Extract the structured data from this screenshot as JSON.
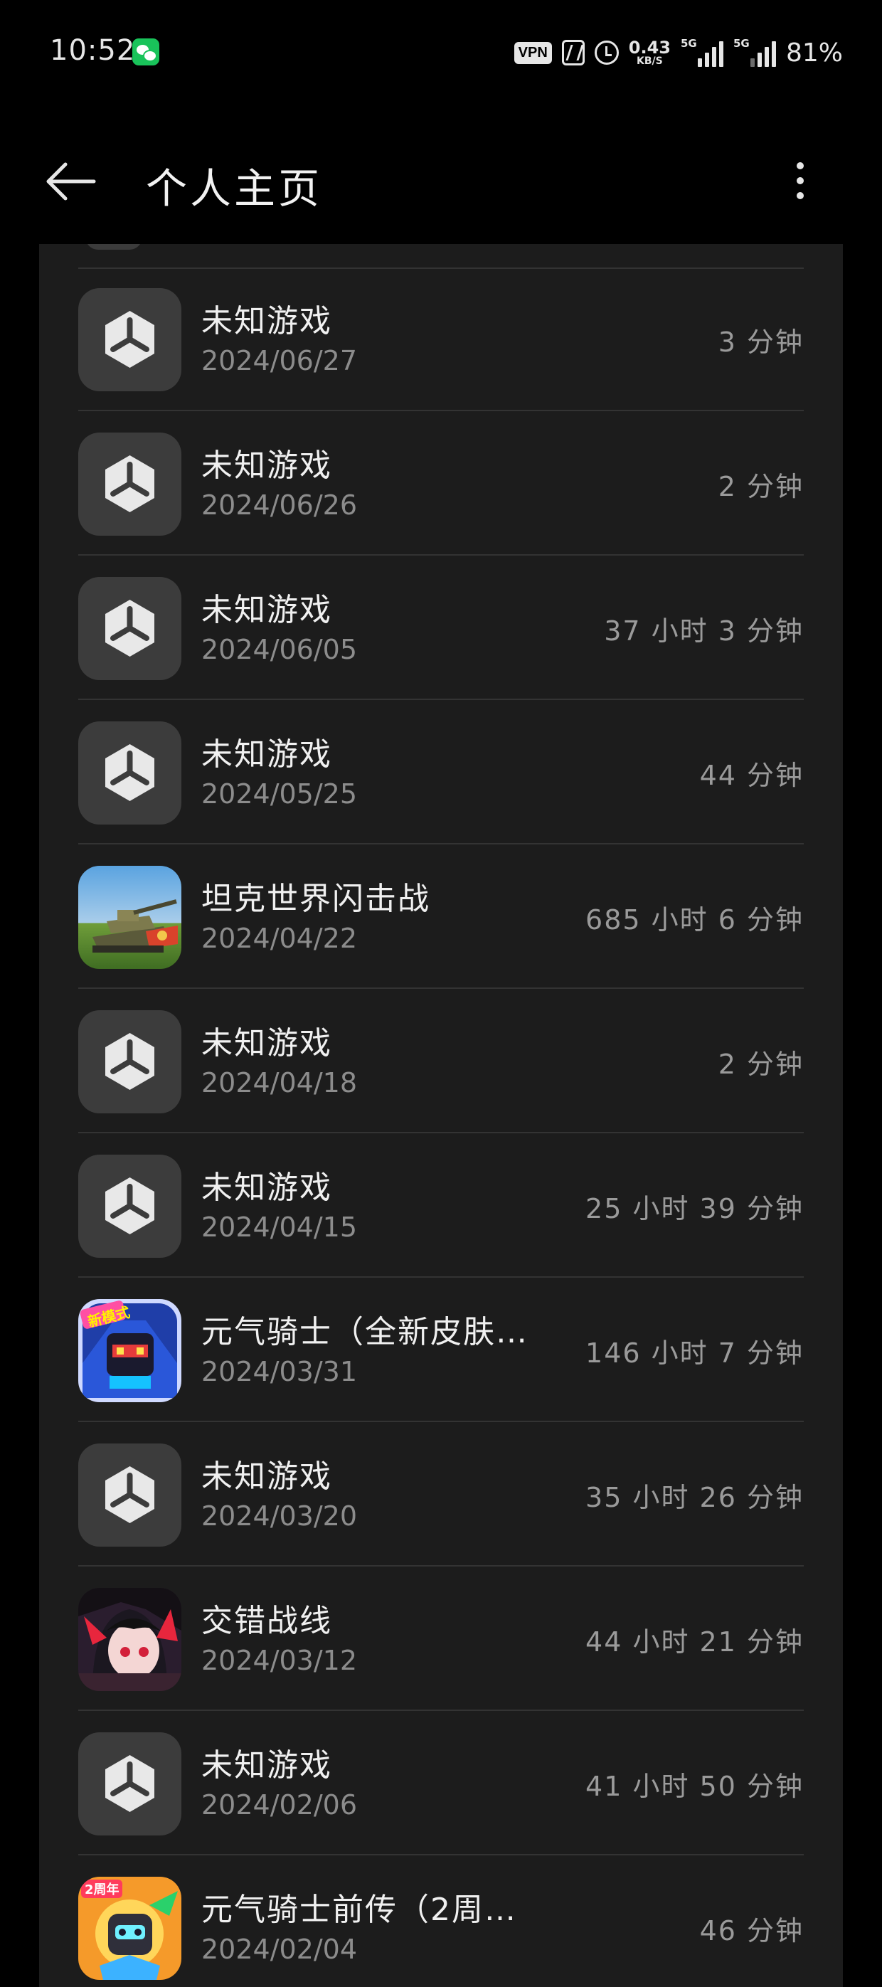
{
  "status_bar": {
    "time": "10:52",
    "vpn_label": "VPN",
    "net_speed_value": "0.43",
    "net_speed_unit": "KB/S",
    "signal_1_label": "5G",
    "signal_2_label": "5G",
    "battery": "81%",
    "icons": [
      "wechat-icon",
      "vpn-icon",
      "nfc-icon",
      "alarm-icon",
      "signal-icon",
      "signal-icon"
    ]
  },
  "app_bar": {
    "title": "个人主页",
    "back_icon": "arrow-left",
    "more_icon": "more-vertical"
  },
  "games": [
    {
      "name": "未知游戏",
      "date": "2024/06/27",
      "playtime": "3 分钟",
      "icon": "unknown-game-icon"
    },
    {
      "name": "未知游戏",
      "date": "2024/06/26",
      "playtime": "2 分钟",
      "icon": "unknown-game-icon"
    },
    {
      "name": "未知游戏",
      "date": "2024/06/05",
      "playtime": "37 小时 3 分钟",
      "icon": "unknown-game-icon"
    },
    {
      "name": "未知游戏",
      "date": "2024/05/25",
      "playtime": "44 分钟",
      "icon": "unknown-game-icon"
    },
    {
      "name": "坦克世界闪击战",
      "date": "2024/04/22",
      "playtime": "685 小时 6 分钟",
      "icon": "tank-game-icon"
    },
    {
      "name": "未知游戏",
      "date": "2024/04/18",
      "playtime": "2 分钟",
      "icon": "unknown-game-icon"
    },
    {
      "name": "未知游戏",
      "date": "2024/04/15",
      "playtime": "25 小时 39 分钟",
      "icon": "unknown-game-icon"
    },
    {
      "name": "元气骑士（全新皮肤…",
      "date": "2024/03/31",
      "playtime": "146 小时 7 分钟",
      "icon": "soul-knight-icon"
    },
    {
      "name": "未知游戏",
      "date": "2024/03/20",
      "playtime": "35 小时 26 分钟",
      "icon": "unknown-game-icon"
    },
    {
      "name": "交错战线",
      "date": "2024/03/12",
      "playtime": "44 小时 21 分钟",
      "icon": "anime-girl-game-icon"
    },
    {
      "name": "未知游戏",
      "date": "2024/02/06",
      "playtime": "41 小时 50 分钟",
      "icon": "unknown-game-icon"
    },
    {
      "name": "元气骑士前传（2周…",
      "date": "2024/02/04",
      "playtime": "46 分钟",
      "icon": "soul-knight-prequel-icon"
    }
  ],
  "colors": {
    "background": "#000000",
    "card": "#1c1c1c",
    "divider": "#333333",
    "primary_text": "#f0f0f0",
    "secondary_text": "#8c8c8c"
  }
}
